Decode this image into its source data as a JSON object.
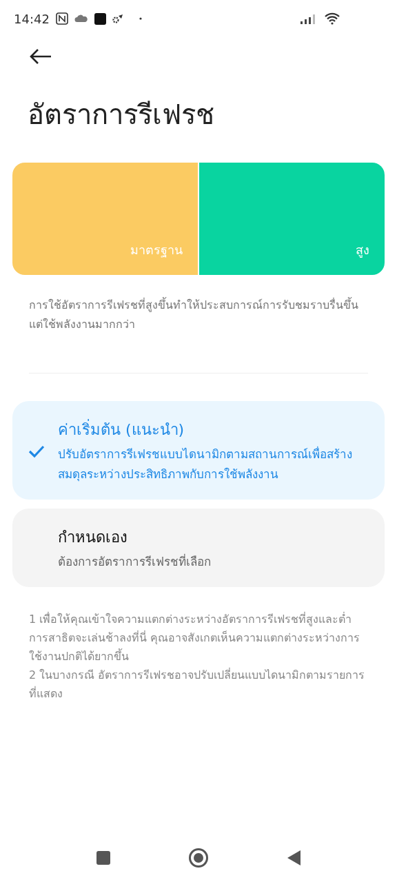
{
  "status_bar": {
    "time": "14:42"
  },
  "title": "อัตราการรีเฟรช",
  "preview": [
    {
      "label": "มาตรฐาน",
      "color": "#fbcb62"
    },
    {
      "label": "สูง",
      "color": "#09d4a0"
    }
  ],
  "description": "การใช้อัตราการรีเฟรชที่สูงขึ้นทำให้ประสบการณ์การรับชมราบรื่นขึ้น แต่ใช้พลังงานมากกว่า",
  "options": [
    {
      "title": "ค่าเริ่มต้น (แนะนำ)",
      "subtitle": "ปรับอัตราการรีเฟรชแบบไดนามิกตามสถานการณ์เพื่อสร้างสมดุลระหว่างประสิทธิภาพกับการใช้พลังงาน",
      "selected": true
    },
    {
      "title": "กำหนดเอง",
      "subtitle": "ต้องการอัตราการรีเฟรชที่เลือก",
      "selected": false
    }
  ],
  "notes": [
    "1 เพื่อให้คุณเข้าใจความแตกต่างระหว่างอัตราการรีเฟรชที่สูงและต่ำ การสาธิตจะเล่นช้าลงที่นี่ คุณอาจสังเกตเห็นความแตกต่างระหว่างการใช้งานปกติได้ยากขึ้น",
    "2 ในบางกรณี อัตราการรีเฟรชอาจปรับเปลี่ยนแบบไดนามิกตามรายการที่แสดง"
  ]
}
